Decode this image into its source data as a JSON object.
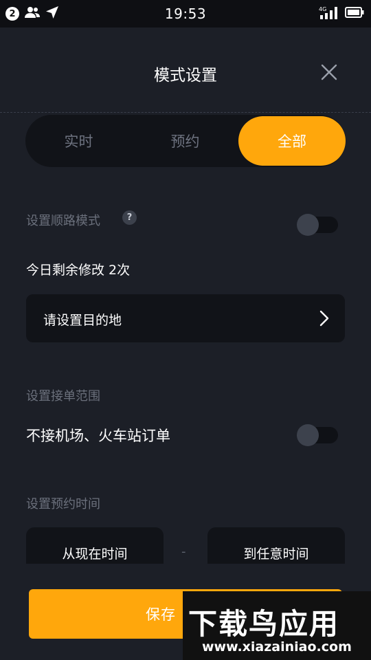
{
  "status_bar": {
    "notification_count": "2",
    "time": "19:53",
    "network": "4G"
  },
  "header": {
    "title": "模式设置"
  },
  "segment_tabs": [
    {
      "label": "实时",
      "selected": false
    },
    {
      "label": "预约",
      "selected": false
    },
    {
      "label": "全部",
      "selected": true
    }
  ],
  "route_mode": {
    "label": "设置顺路模式",
    "help_symbol": "?",
    "enabled": false,
    "remaining_text": "今日剩余修改 2次",
    "destination_placeholder": "请设置目的地"
  },
  "order_range": {
    "label": "设置接单范围",
    "option_label": "不接机场、火车站订单",
    "enabled": false
  },
  "booking_time": {
    "label": "设置预约时间",
    "from_label": "从现在时间",
    "separator": "-",
    "to_label": "到任意时间"
  },
  "footer": {
    "save_label": "保存"
  },
  "watermark": {
    "logo_text": "下载鸟应用",
    "url": "www.xiazainiao.com"
  },
  "colors": {
    "accent": "#ffa70c",
    "background": "#1c1f27",
    "card": "#111318",
    "muted_text": "#6b707c"
  }
}
